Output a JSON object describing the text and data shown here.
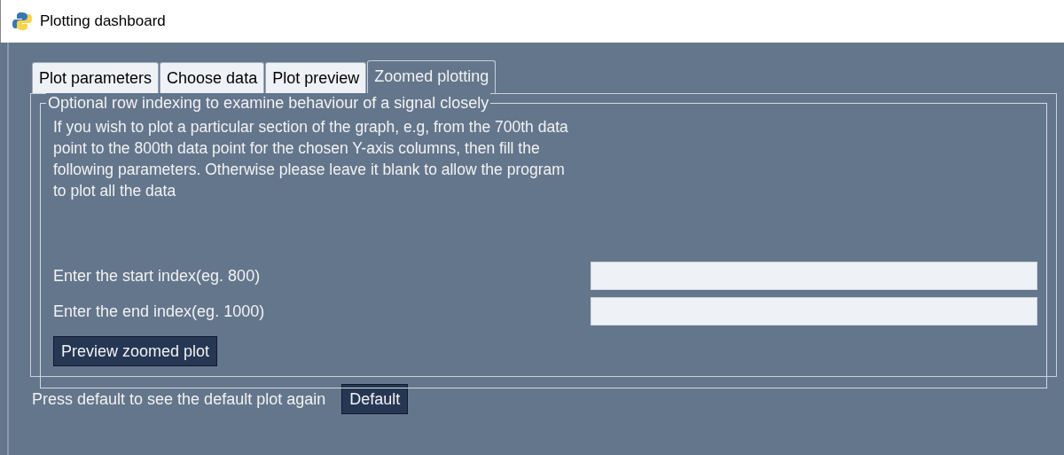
{
  "window": {
    "title": "Plotting dashboard"
  },
  "tabs": [
    {
      "label": "Plot parameters",
      "selected": false
    },
    {
      "label": "Choose data",
      "selected": false
    },
    {
      "label": "Plot preview",
      "selected": false
    },
    {
      "label": "Zoomed plotting",
      "selected": true
    }
  ],
  "group": {
    "title": "Optional row indexing to examine behaviour of a signal closely",
    "description": "If you wish to plot a particular section of the graph, e.g, from the 700th data point to the 800th data point for the chosen Y-axis columns, then fill the following parameters. Otherwise please leave it blank to allow the program to plot all the data",
    "fields": [
      {
        "label": "Enter the start index(eg. 800)"
      },
      {
        "label": "Enter the end index(eg. 1000)"
      }
    ],
    "button": "Preview zoomed plot"
  },
  "footer": {
    "text": "Press default to see the default plot again",
    "button": "Default"
  }
}
